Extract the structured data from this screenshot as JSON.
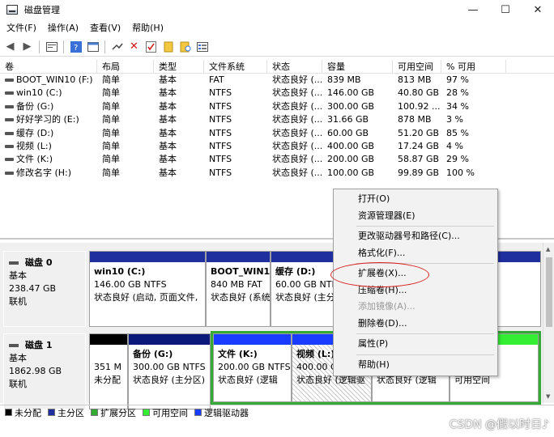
{
  "window": {
    "title": "磁盘管理",
    "min": "—",
    "max": "☐",
    "close": "✕"
  },
  "menubar": [
    "文件(F)",
    "操作(A)",
    "查看(V)",
    "帮助(H)"
  ],
  "toolbar": {
    "icons": [
      "back-arrow-icon",
      "forward-arrow-icon",
      "properties-icon",
      "help-icon",
      "console-icon",
      "connect-icon",
      "delete-icon",
      "check-icon",
      "folder-icon",
      "folder-search-icon",
      "list-icon"
    ]
  },
  "table": {
    "headers": [
      "卷",
      "布局",
      "类型",
      "文件系统",
      "状态",
      "容量",
      "可用空间",
      "% 可用"
    ],
    "rows": [
      [
        "BOOT_WIN10 (F:)",
        "简单",
        "基本",
        "FAT",
        "状态良好 (...",
        "839 MB",
        "813 MB",
        "97 %"
      ],
      [
        "win10 (C:)",
        "简单",
        "基本",
        "NTFS",
        "状态良好 (...",
        "146.00 GB",
        "40.80 GB",
        "28 %"
      ],
      [
        "备份 (G:)",
        "简单",
        "基本",
        "NTFS",
        "状态良好 (...",
        "300.00 GB",
        "100.92 ...",
        "34 %"
      ],
      [
        "好好学习的 (E:)",
        "简单",
        "基本",
        "NTFS",
        "状态良好 (...",
        "31.66 GB",
        "878 MB",
        "3 %"
      ],
      [
        "缓存 (D:)",
        "简单",
        "基本",
        "NTFS",
        "状态良好 (...",
        "60.00 GB",
        "51.20 GB",
        "85 %"
      ],
      [
        "视频 (L:)",
        "简单",
        "基本",
        "NTFS",
        "状态良好 (...",
        "400.00 GB",
        "17.24 GB",
        "4 %"
      ],
      [
        "文件 (K:)",
        "简单",
        "基本",
        "NTFS",
        "状态良好 (...",
        "200.00 GB",
        "58.87 GB",
        "29 %"
      ],
      [
        "修改名字 (H:)",
        "简单",
        "基本",
        "NTFS",
        "状态良好 (...",
        "100.00 GB",
        "99.89 GB",
        "100 %"
      ]
    ]
  },
  "disks": {
    "disk0": {
      "name": "磁盘 0",
      "type": "基本",
      "size": "238.47 GB",
      "status": "联机",
      "parts": [
        {
          "name": "win10  (C:)",
          "fs": "146.00 GB NTFS",
          "status": "状态良好 (启动, 页面文件,"
        },
        {
          "name": "BOOT_WIN1",
          "fs": "840 MB FAT",
          "status": "状态良好 (系统"
        },
        {
          "name": "缓存  (D:)",
          "fs": "60.00 GB NTFS",
          "status": "状态良好 (主分"
        }
      ]
    },
    "disk1": {
      "name": "磁盘 1",
      "type": "基本",
      "size": "1862.98 GB",
      "status": "联机",
      "parts": [
        {
          "name": "",
          "fs": "351 M",
          "status": "未分配"
        },
        {
          "name": "备份  (G:)",
          "fs": "300.00 GB NTFS",
          "status": "状态良好 (主分区)"
        },
        {
          "name": "文件  (K:)",
          "fs": "200.00 GB NTFS",
          "status": "状态良好 (逻辑"
        },
        {
          "name": "视频  (L:)",
          "fs": "400.00 G",
          "status": "状态良好 (逻辑驱"
        },
        {
          "name": "",
          "fs": "",
          "status": "状态良好 (逻辑"
        },
        {
          "name": "",
          "fs": "",
          "status": "可用空间"
        }
      ]
    }
  },
  "legend": [
    {
      "label": "未分配",
      "color": "#000000"
    },
    {
      "label": "主分区",
      "color": "#1f2f9e"
    },
    {
      "label": "扩展分区",
      "color": "#33aa33"
    },
    {
      "label": "可用空间",
      "color": "#33ee33"
    },
    {
      "label": "逻辑驱动器",
      "color": "#1a3cff"
    }
  ],
  "context_menu": {
    "items": [
      "打开(O)",
      "资源管理器(E)",
      "更改驱动器号和路径(C)...",
      "格式化(F)...",
      "扩展卷(X)...",
      "压缩卷(H)...",
      "添加镜像(A)...",
      "删除卷(D)...",
      "属性(P)",
      "帮助(H)"
    ],
    "disabled": [
      "添加镜像(A)..."
    ]
  },
  "watermark": "CSDN @假以时日♪"
}
